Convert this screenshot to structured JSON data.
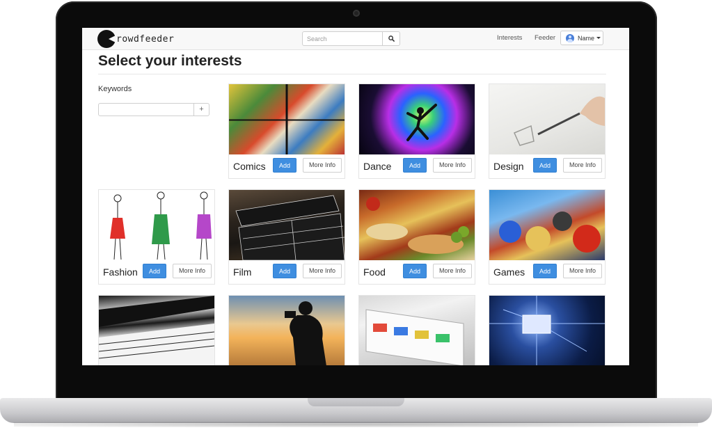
{
  "app": {
    "logo_text": "rowdfeeder"
  },
  "navbar": {
    "search_placeholder": "Search",
    "links": [
      "Interests",
      "Feeder"
    ],
    "user_label": "Name"
  },
  "page": {
    "title": "Select your interests",
    "keywords_label": "Keywords",
    "keywords_value": "",
    "keywords_add_label": "+"
  },
  "buttons": {
    "add": "Add",
    "more_info": "More Info"
  },
  "interests": [
    {
      "name": "Comics",
      "image": "comics"
    },
    {
      "name": "Dance",
      "image": "dance"
    },
    {
      "name": "Design",
      "image": "design"
    },
    {
      "name": "Fashion",
      "image": "fashion"
    },
    {
      "name": "Film",
      "image": "film"
    },
    {
      "name": "Food",
      "image": "food"
    },
    {
      "name": "Games",
      "image": "games"
    },
    {
      "name": "",
      "image": "music"
    },
    {
      "name": "",
      "image": "photography"
    },
    {
      "name": "",
      "image": "printing"
    },
    {
      "name": "",
      "image": "technology"
    }
  ]
}
